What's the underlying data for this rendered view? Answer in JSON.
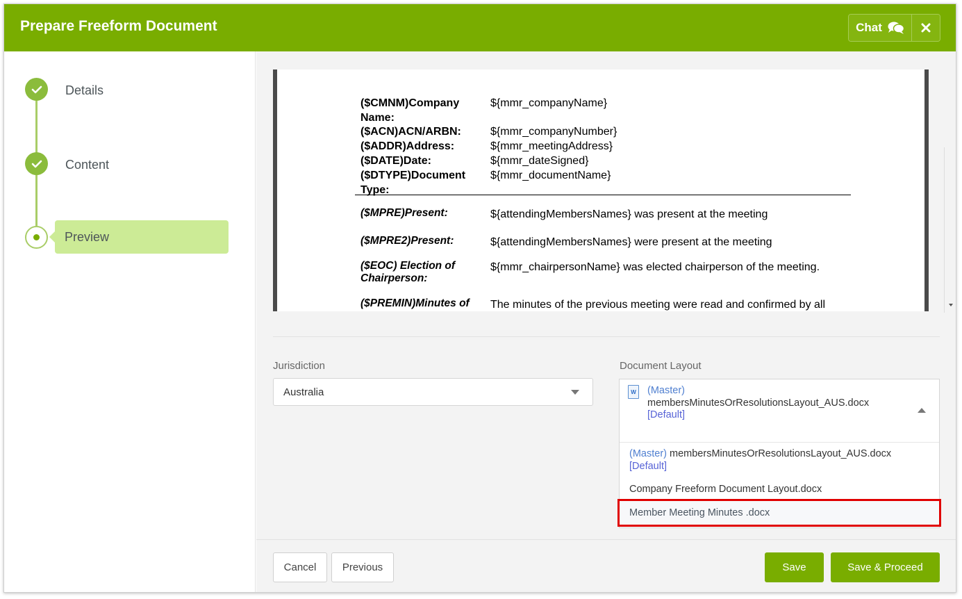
{
  "header": {
    "title": "Prepare Freeform Document",
    "chat_label": "Chat"
  },
  "steps": [
    {
      "label": "Details",
      "state": "done"
    },
    {
      "label": "Content",
      "state": "done"
    },
    {
      "label": "Preview",
      "state": "current"
    }
  ],
  "document": {
    "header_rows": [
      {
        "label": "($CMNM)Company Name:",
        "value": "${mmr_companyName}"
      },
      {
        "label": "($ACN)ACN/ARBN:",
        "value": "${mmr_companyNumber}"
      },
      {
        "label": "($ADDR)Address:",
        "value": "${mmr_meetingAddress}"
      },
      {
        "label": "($DATE)Date:",
        "value": "${mmr_dateSigned}"
      },
      {
        "label": "($DTYPE)Document Type:",
        "value": "${mmr_documentName}"
      }
    ],
    "body_rows": [
      {
        "label": "($MPRE)Present:",
        "value": "${attendingMembersNames} was present at the meeting"
      },
      {
        "label": "($MPRE2)Present:",
        "value": "${attendingMembersNames} were present at the meeting"
      },
      {
        "label": "($EOC) Election of Chairperson:",
        "value": "${mmr_chairpersonName} was elected chairperson of the meeting."
      },
      {
        "label": "($PREMIN)Minutes of",
        "value": "The minutes of the previous meeting were read and confirmed by all"
      }
    ]
  },
  "jurisdiction": {
    "label": "Jurisdiction",
    "value": "Australia"
  },
  "layout": {
    "label": "Document Layout",
    "selected": {
      "master": "(Master)",
      "name": "membersMinutesOrResolutionsLayout_AUS.docx",
      "default": "[Default]"
    },
    "options": [
      {
        "master": "(Master)",
        "name": "membersMinutesOrResolutionsLayout_AUS.docx",
        "default": "[Default]"
      },
      {
        "name": "Company Freeform Document Layout.docx"
      },
      {
        "name": "Member Meeting Minutes .docx"
      }
    ]
  },
  "footer": {
    "cancel": "Cancel",
    "previous": "Previous",
    "save": "Save",
    "save_proceed": "Save & Proceed"
  },
  "colors": {
    "brand": "#79ad00",
    "step_active_bg": "#cceb96",
    "highlight": "#e00000"
  }
}
